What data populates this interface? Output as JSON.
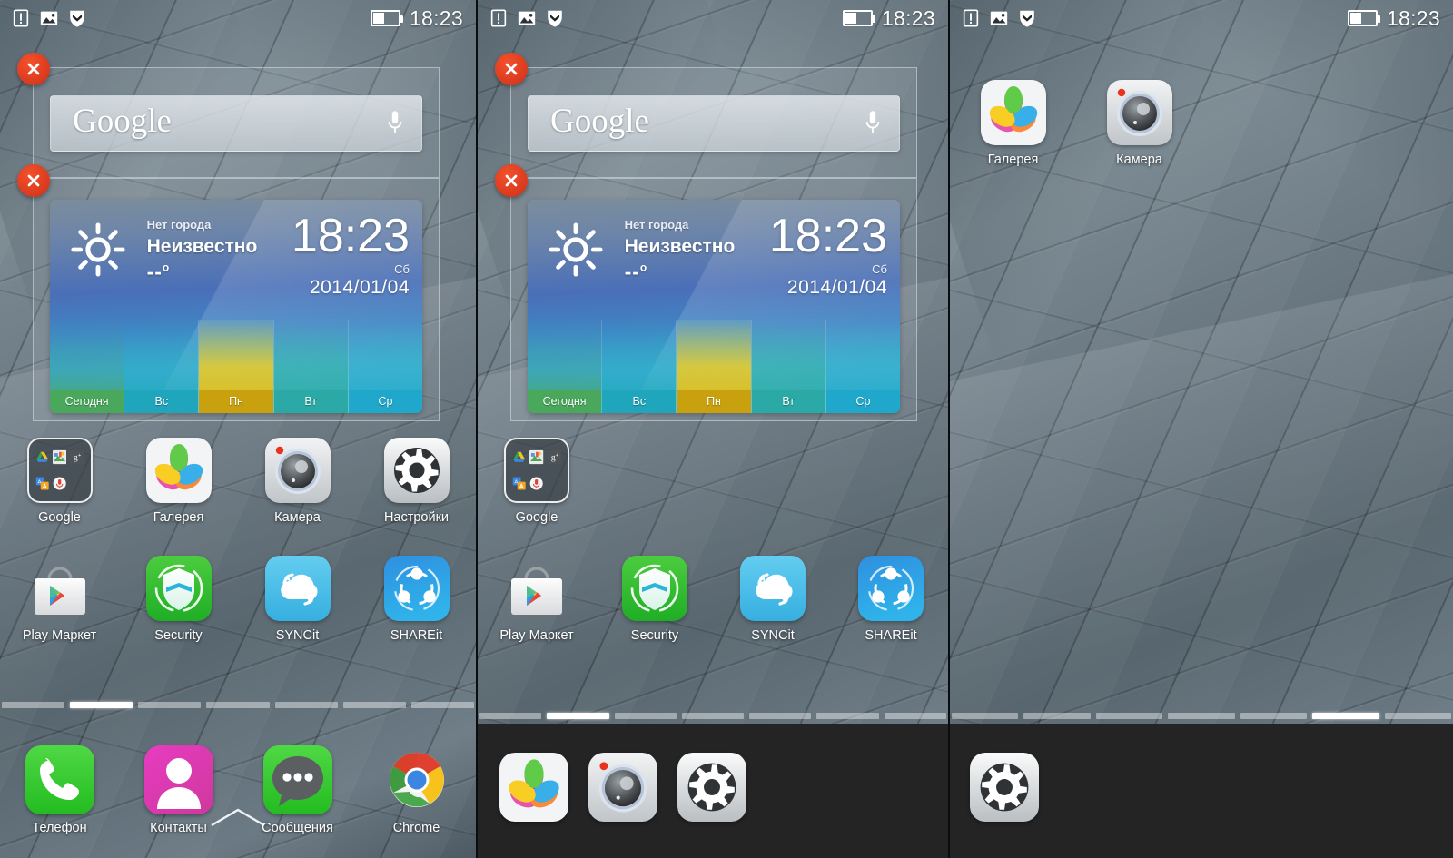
{
  "statusbar": {
    "time": "18:23",
    "icons": [
      "sim-warning-icon",
      "screenshot-image-icon",
      "security-shield-icon"
    ],
    "battery_level_percent": 40
  },
  "google_widget": {
    "logo_text": "Google",
    "mic_icon": "microphone-icon",
    "delete_icon": "close-x-icon"
  },
  "weather_widget": {
    "city": "Нет города",
    "condition": "Неизвестно",
    "temperature": "--",
    "degree": "o",
    "clock": "18:23",
    "day_of_week": "Сб",
    "date": "2014/01/04",
    "weather_icon": "sun-icon",
    "delete_icon": "close-x-icon",
    "forecast": [
      {
        "label": "Сегодня",
        "color": "#4aa85c",
        "top_color": "#3fa6b8"
      },
      {
        "label": "Вс",
        "color": "#1fa6bd",
        "top_color": "#2ab4d2"
      },
      {
        "label": "Пн",
        "color": "#c9a00d",
        "top_color": "#f0d02b"
      },
      {
        "label": "Вт",
        "color": "#2aa9a6",
        "top_color": "#31b5ae"
      },
      {
        "label": "Ср",
        "color": "#1fa8cb",
        "top_color": "#2cb3d8"
      }
    ]
  },
  "panel1": {
    "row1": [
      {
        "label": "Google",
        "icon": "google-folder-icon",
        "type": "folder"
      },
      {
        "label": "Галерея",
        "icon": "gallery-flower-icon",
        "type": "app"
      },
      {
        "label": "Камера",
        "icon": "camera-lens-icon",
        "type": "app"
      },
      {
        "label": "Настройки",
        "icon": "settings-gear-icon",
        "type": "app"
      }
    ],
    "row2": [
      {
        "label": "Play Маркет",
        "icon": "play-store-icon",
        "type": "app"
      },
      {
        "label": "Security",
        "icon": "security-shield-icon",
        "type": "app"
      },
      {
        "label": "SYNCit",
        "icon": "syncit-cloud-icon",
        "type": "app"
      },
      {
        "label": "SHAREit",
        "icon": "shareit-share-icon",
        "type": "app"
      }
    ],
    "dock": [
      {
        "label": "Телефон",
        "icon": "phone-handset-icon"
      },
      {
        "label": "Контакты",
        "icon": "contacts-person-icon"
      },
      {
        "label": "Сообщения",
        "icon": "messages-bubble-icon"
      },
      {
        "label": "Chrome",
        "icon": "chrome-icon"
      }
    ],
    "drawer_caret_icon": "chevron-up-icon",
    "pager": {
      "count": 7,
      "active_index": 1
    }
  },
  "panel2": {
    "row1": [
      {
        "label": "Google",
        "icon": "google-folder-icon",
        "type": "folder"
      }
    ],
    "row2": [
      {
        "label": "Play Маркет",
        "icon": "play-store-icon",
        "type": "app"
      },
      {
        "label": "Security",
        "icon": "security-shield-icon",
        "type": "app"
      },
      {
        "label": "SYNCit",
        "icon": "syncit-cloud-icon",
        "type": "app"
      },
      {
        "label": "SHAREit",
        "icon": "shareit-share-icon",
        "type": "app"
      }
    ],
    "dock": [
      {
        "icon": "gallery-flower-icon",
        "name": "gallery"
      },
      {
        "icon": "camera-lens-icon",
        "name": "camera"
      },
      {
        "icon": "settings-gear-icon",
        "name": "settings"
      }
    ],
    "pager": {
      "count": 7,
      "active_index": 1
    }
  },
  "panel3": {
    "row1": [
      {
        "label": "Галерея",
        "icon": "gallery-flower-icon",
        "type": "app"
      },
      {
        "label": "Камера",
        "icon": "camera-lens-icon",
        "type": "app"
      }
    ],
    "dock": [
      {
        "icon": "settings-gear-icon",
        "name": "settings"
      }
    ],
    "pager": {
      "count": 7,
      "active_index": 5
    }
  },
  "colors": {
    "delete_red": "#d8391d",
    "dock_dark": "#242424",
    "wallpaper_base": "#67757f",
    "accent_white": "#ffffff"
  }
}
